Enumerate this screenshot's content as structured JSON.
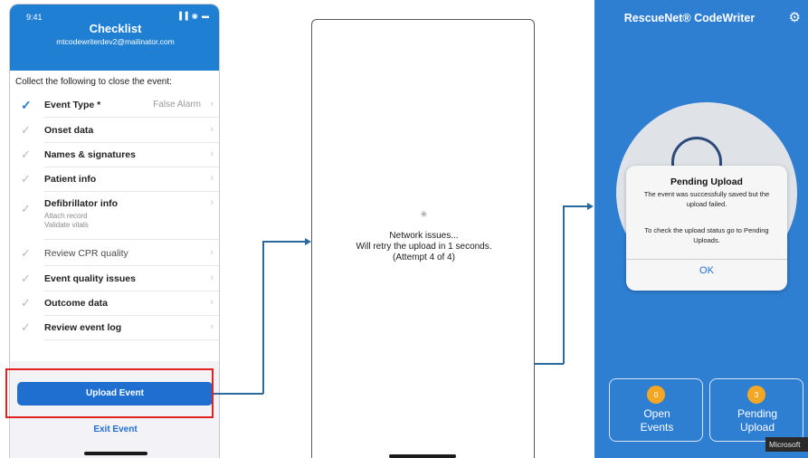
{
  "checklist_screen": {
    "status_time": "9:41",
    "status_icons": "▐▐ ◉ ▬",
    "title": "Checklist",
    "account": "mtcodewriterdev2@mailinator.com",
    "intro": "Collect the following to close the event:",
    "items": [
      {
        "label": "Event Type *",
        "value": "False Alarm",
        "checked": true
      },
      {
        "label": "Onset data"
      },
      {
        "label": "Names & signatures"
      },
      {
        "label": "Patient info"
      },
      {
        "label": "Defibrillator info",
        "sublines": [
          "Attach record",
          "Validate vitals"
        ]
      },
      {
        "label": "Review CPR quality"
      },
      {
        "label": "Event quality issues"
      },
      {
        "label": "Outcome data"
      },
      {
        "label": "Review event log"
      }
    ],
    "check_glyph": "✓",
    "chevron_glyph": "›",
    "upload_button": "Upload Event",
    "exit_button": "Exit Event"
  },
  "network_screen": {
    "spinner_glyph": "✳",
    "line1": "Network issues...",
    "line2": "Will retry the upload in 1 seconds.",
    "line3": "(Attempt 4 of 4)"
  },
  "rescuenet_screen": {
    "title": "RescueNet® CodeWriter",
    "gear_glyph": "⚙",
    "dialog": {
      "title": "Pending Upload",
      "message1": "The event was successfully saved but the upload failed.",
      "message2": "To check the upload status go to Pending Uploads.",
      "ok": "OK"
    },
    "tiles": [
      {
        "count": "0",
        "label_line1": "Open",
        "label_line2": "Events"
      },
      {
        "count": "3",
        "label_line1": "Pending",
        "label_line2": "Upload"
      }
    ],
    "corner_tag": "Microsoft"
  },
  "colors": {
    "accent": "#1f7fd3",
    "highlight": "#e0211e",
    "connector": "#2d6a9b",
    "badge": "#f5a623"
  }
}
